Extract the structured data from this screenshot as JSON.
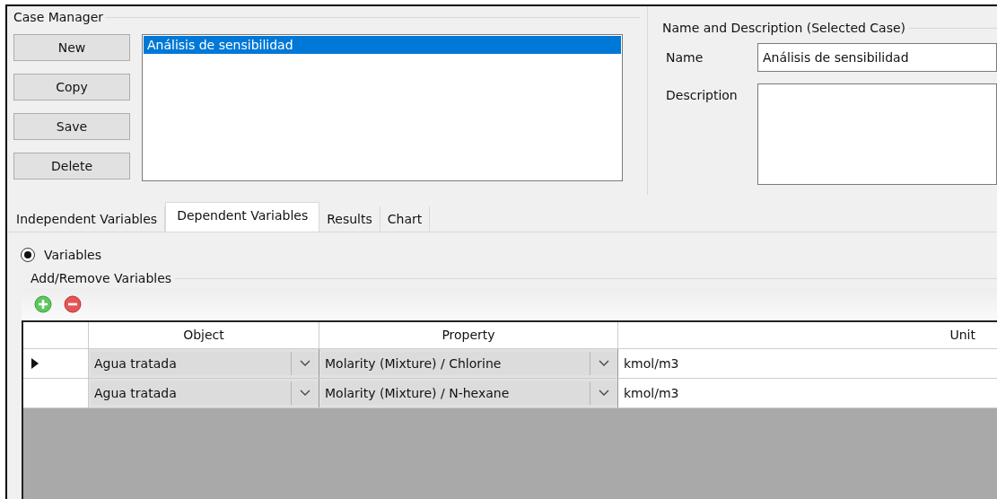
{
  "case_manager": {
    "title": "Case Manager",
    "buttons": [
      "New",
      "Copy",
      "Save",
      "Delete"
    ],
    "cases": [
      {
        "label": "Análisis de sensibilidad",
        "selected": true
      }
    ]
  },
  "details": {
    "title": "Name and Description (Selected Case)",
    "name_label": "Name",
    "name_value": "Análisis de sensibilidad",
    "description_label": "Description"
  },
  "tabs": [
    {
      "label": "Independent Variables",
      "selected": false
    },
    {
      "label": "Dependent Variables",
      "selected": true
    },
    {
      "label": "Results",
      "selected": false
    },
    {
      "label": "Chart",
      "selected": false
    }
  ],
  "radio": {
    "label": "Variables",
    "selected": true
  },
  "variables_group": {
    "title": "Add/Remove Variables"
  },
  "table": {
    "columns": [
      "Object",
      "Property",
      "Unit"
    ],
    "rows": [
      {
        "current": true,
        "object": "Agua tratada",
        "property": "Molarity (Mixture) / Chlorine",
        "unit": "kmol/m3"
      },
      {
        "current": false,
        "object": "Agua tratada",
        "property": "Molarity (Mixture) / N-hexane",
        "unit": "kmol/m3"
      }
    ]
  }
}
